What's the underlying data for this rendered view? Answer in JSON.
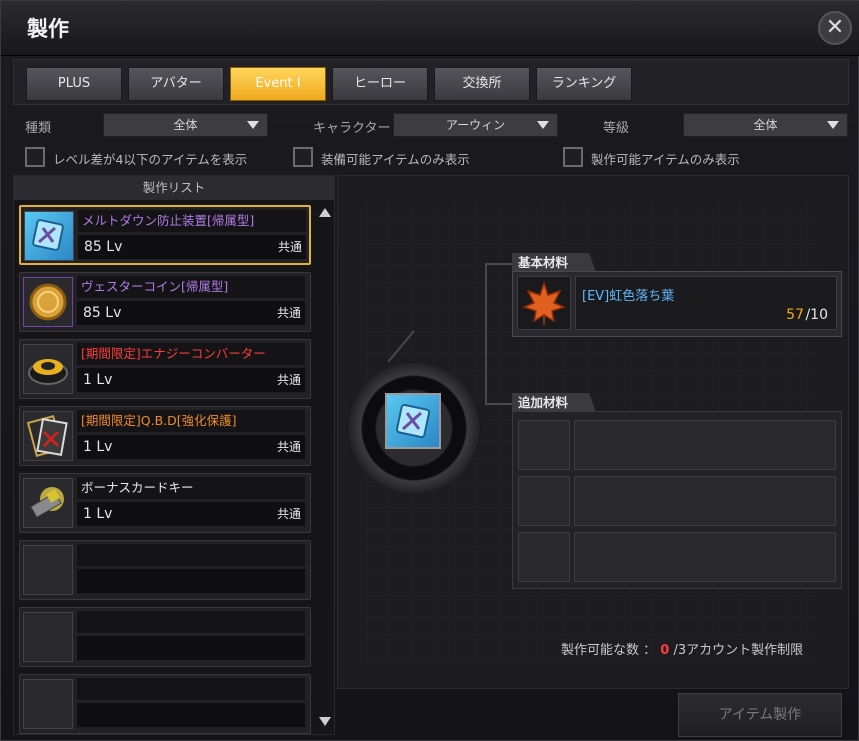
{
  "window": {
    "title": "製作",
    "close_glyph": "✕"
  },
  "tabs": [
    {
      "label": "PLUS"
    },
    {
      "label": "アバター"
    },
    {
      "label": "Event Ⅰ"
    },
    {
      "label": "ヒーロー"
    },
    {
      "label": "交換所"
    },
    {
      "label": "ランキング"
    }
  ],
  "filters": {
    "type_label": "種類",
    "type_value": "全体",
    "character_label": "キャラクター",
    "character_value": "アーウィン",
    "grade_label": "等級",
    "grade_value": "全体"
  },
  "checks": [
    {
      "label": "レベル差が4以下のアイテムを表示"
    },
    {
      "label": "装備可能アイテムのみ表示"
    },
    {
      "label": "製作可能アイテムのみ表示"
    }
  ],
  "list": {
    "header": "製作リスト",
    "items": [
      {
        "name": "メルトダウン防止装置[帰属型]",
        "level": "85",
        "lv": "Lv",
        "share": "共通",
        "name_color": "#b07be6",
        "icon": "meltdown-device-icon"
      },
      {
        "name": "ヴェスターコイン[帰属型]",
        "level": "85",
        "lv": "Lv",
        "share": "共通",
        "name_color": "#b07be6",
        "icon": "coin-icon"
      },
      {
        "name": "[期間限定]エナジーコンバーター",
        "level": "1",
        "lv": "Lv",
        "share": "共通",
        "name_color": "#ff3b3b",
        "icon": "energy-converter-icon"
      },
      {
        "name": "[期間限定]Q.B.D[強化保護]",
        "level": "1",
        "lv": "Lv",
        "share": "共通",
        "name_color": "#f08a2a",
        "icon": "qbd-card-icon"
      },
      {
        "name": "ボーナスカードキー",
        "level": "1",
        "lv": "Lv",
        "share": "共通",
        "name_color": "#e8e8e8",
        "icon": "bonus-card-key-icon"
      }
    ]
  },
  "materials": {
    "base_label": "基本材料",
    "base_item": {
      "name": "[EV]虹色落ち葉",
      "have": "57",
      "need": "/10",
      "icon": "maple-leaf-icon"
    },
    "extra_label": "追加材料"
  },
  "craft_limit": {
    "prefix": "製作可能な数 ：",
    "count": "0",
    "suffix": "/3アカウント製作制限"
  },
  "craft_button": "アイテム製作",
  "colors": {
    "accent": "#f0a91f",
    "highlight": "#e2b13c",
    "count_zero": "#ff3b3b",
    "have_count": "#f0a91f",
    "material_name": "#5fb8ff"
  }
}
